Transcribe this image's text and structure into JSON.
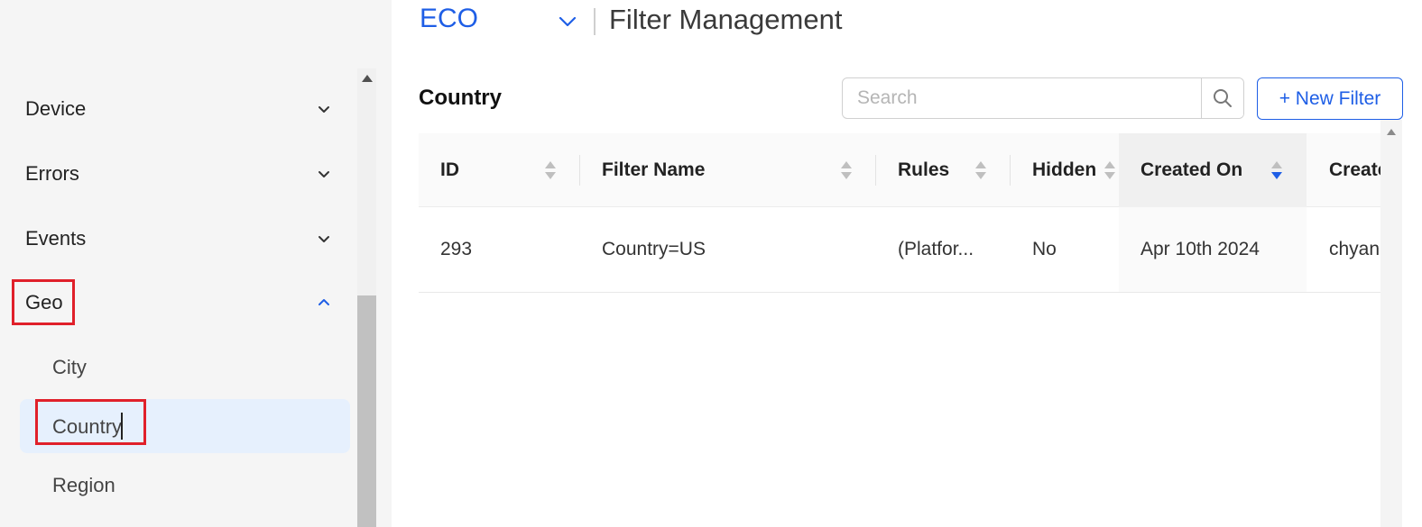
{
  "header": {
    "app_name": "ECO",
    "page_title": "Filter Management"
  },
  "sidebar": {
    "items": [
      {
        "label": "Device",
        "expanded": false
      },
      {
        "label": "Errors",
        "expanded": false
      },
      {
        "label": "Events",
        "expanded": false
      },
      {
        "label": "Geo",
        "expanded": true
      }
    ],
    "geo_children": [
      "City",
      "Country",
      "Region"
    ],
    "active_child": "Country"
  },
  "section": {
    "title": "Country",
    "search_placeholder": "Search",
    "new_filter_label": "+ New Filter"
  },
  "table": {
    "columns": [
      "ID",
      "Filter Name",
      "Rules",
      "Hidden",
      "Created On",
      "Create"
    ],
    "sorted_column": "Created On",
    "rows": [
      {
        "id": "293",
        "filter_name": "Country=US",
        "rules": "(Platfor...",
        "hidden": "No",
        "created_on": "Apr 10th 2024",
        "created_by": "chyan"
      }
    ]
  },
  "colors": {
    "accent": "#1e5ee6",
    "highlight": "#e0202a",
    "active_bg": "#e6f0fd",
    "sidebar_bg": "#f5f5f5"
  }
}
